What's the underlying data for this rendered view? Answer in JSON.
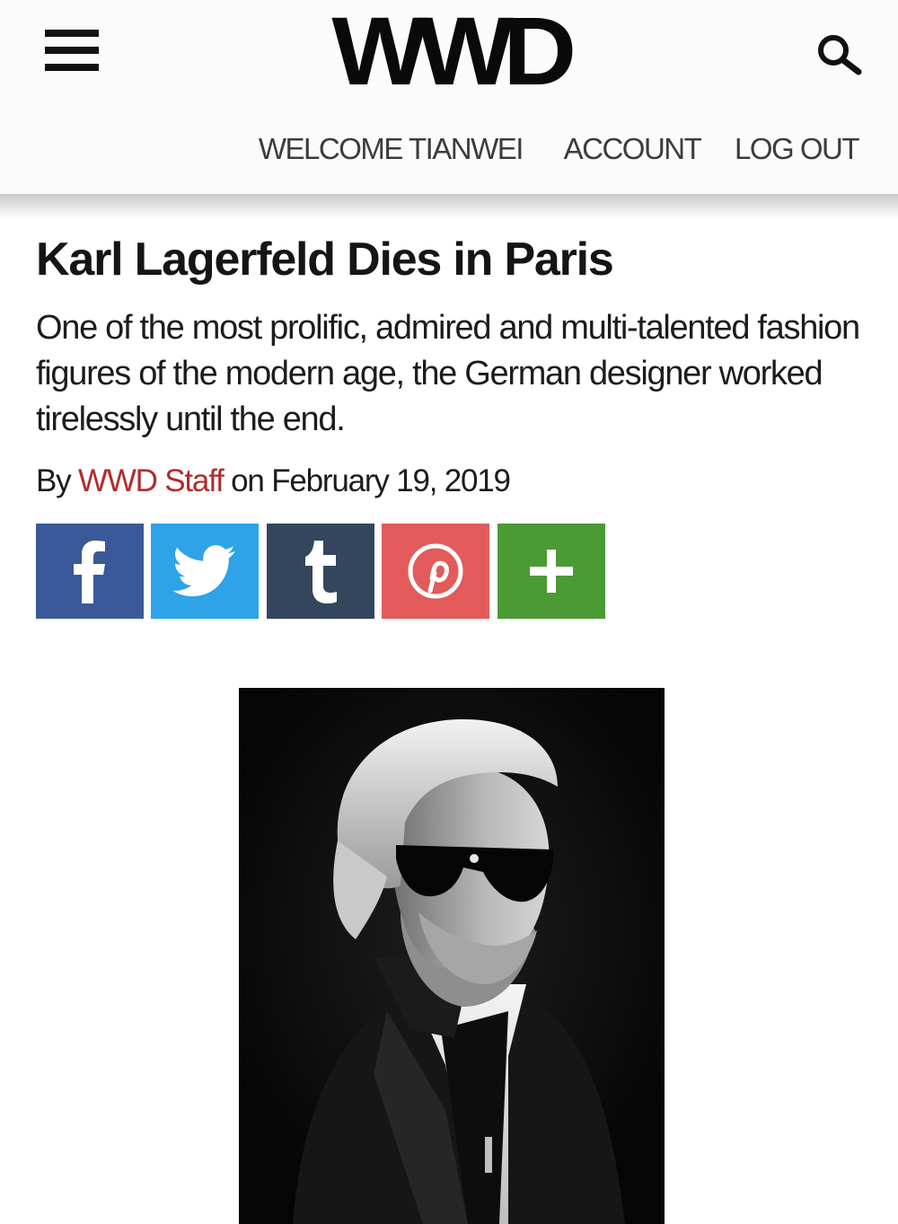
{
  "header": {
    "logo_text": "WWD",
    "menu_icon": "hamburger-menu-icon",
    "search_icon": "search-icon",
    "welcome_text": "WELCOME TIANWEI",
    "account_label": "ACCOUNT",
    "logout_label": "LOG OUT"
  },
  "article": {
    "headline": "Karl Lagerfeld Dies in Paris",
    "dek": "One of the most prolific, admired and multi-talented fashion figures of the modern age, the German designer worked tirelessly until the end.",
    "byline_prefix": "By",
    "author": "WWD Staff",
    "date_prefix": "on",
    "date": "February 19, 2019"
  },
  "share": [
    {
      "network": "facebook",
      "icon": "facebook-icon",
      "color": "#3b5998"
    },
    {
      "network": "twitter",
      "icon": "twitter-icon",
      "color": "#2fa3e8"
    },
    {
      "network": "tumblr",
      "icon": "tumblr-icon",
      "color": "#33465d"
    },
    {
      "network": "pinterest",
      "icon": "pinterest-icon",
      "color": "#e35a5a"
    },
    {
      "network": "more",
      "icon": "plus-icon",
      "color": "#4c9a35"
    }
  ],
  "colors": {
    "author_link": "#b02c2c",
    "header_bg": "#fbfbfb",
    "photo_bg": "#0b0b0b"
  }
}
